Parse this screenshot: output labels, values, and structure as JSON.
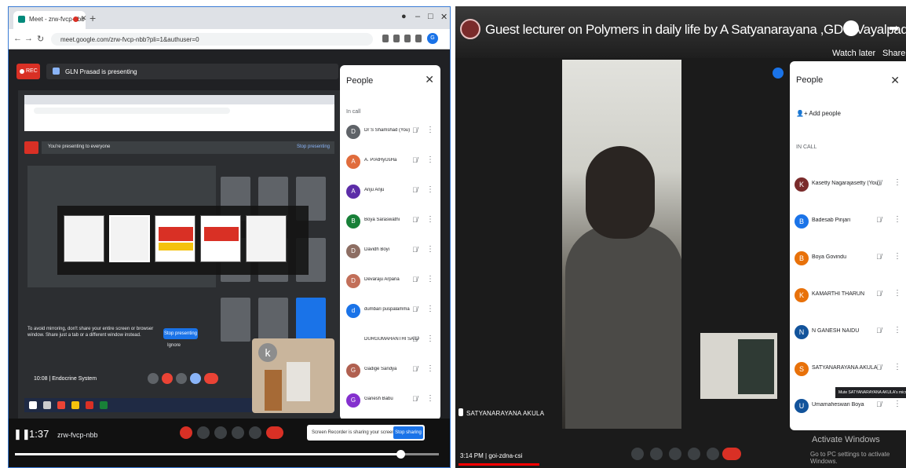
{
  "left": {
    "browser": {
      "tab_label": "Meet - zrw-fvcp-nbb",
      "address": "meet.google.com/zrw-fvcp-nbb?pli=1&authuser=0"
    },
    "meet": {
      "rec_label": "REC",
      "presenting_text": "GLN Prasad is presenting"
    },
    "shared_screen": {
      "sharing_banner": "You're presenting to everyone",
      "stop_presenting": "Stop presenting",
      "mirror_text": "To avoid mirroring, don't share your entire screen or browser window. Share just a tab or a different window instead.",
      "stop_button": "Stop presenting",
      "ignore_link": "Ignore",
      "meeting_info": "10:08 | Endocrine System",
      "pip_initial": "k"
    },
    "people": {
      "title": "People",
      "in_call": "In call",
      "members": [
        {
          "initial": "D",
          "name": "Dr S Shamshad (You)",
          "color": "#5f6368"
        },
        {
          "initial": "A",
          "name": "A. PrAtHyUsHa",
          "color": "#e06c3c"
        },
        {
          "initial": "A",
          "name": "Anju Anju",
          "color": "#5c2da8"
        },
        {
          "initial": "B",
          "name": "Boya Saraswathi",
          "color": "#188038"
        },
        {
          "initial": "D",
          "name": "Davidh Boyi",
          "color": "#8d6e63"
        },
        {
          "initial": "D",
          "name": "Devaraju Arpana",
          "color": "#c26f59"
        },
        {
          "initial": "d",
          "name": "dumbari puspalamma",
          "color": "#1a73e8"
        },
        {
          "initial": "",
          "name": "DURGUMAHANTHI SAILA...",
          "color": "#ffffff"
        },
        {
          "initial": "G",
          "name": "Gadige Sandya",
          "color": "#b06050"
        },
        {
          "initial": "G",
          "name": "Ganesh Babu",
          "color": "#8430ce"
        }
      ]
    },
    "player": {
      "time": "1:37",
      "meeting_code": "zrw-fvcp-nbb",
      "recorder_notice": "Screen Recorder is sharing your screen and audio.",
      "stop_sharing": "Stop sharing",
      "progress": 0.91
    }
  },
  "right": {
    "video_title": "Guest lecturer on Polymers in daily life by A Satyanarayana ,GDC,Vayalpadu",
    "watch_later": "Watch later",
    "share": "Share",
    "speaker_name": "SATYANARAYANA AKULA",
    "meeting_time": "3:14 PM",
    "meeting_code": "goi-zdna-csi",
    "activate_windows": "Activate Windows",
    "go_to_pc": "Go to PC settings to activate Windows.",
    "people": {
      "title": "People",
      "add_people": "Add people",
      "in_call": "IN CALL",
      "members": [
        {
          "initial": "K",
          "name": "Kasetty Nagarajasetty (You)",
          "color": "#7a2b2b"
        },
        {
          "initial": "B",
          "name": "Badesab Pinjari",
          "color": "#1a73e8"
        },
        {
          "initial": "B",
          "name": "Boya Govindu",
          "color": "#e8710a"
        },
        {
          "initial": "K",
          "name": "KAMARTHI THARUN",
          "color": "#e8710a"
        },
        {
          "initial": "N",
          "name": "N GANESH NAIDU",
          "color": "#12539b"
        },
        {
          "initial": "S",
          "name": "SATYANARAYANA AKULA",
          "color": "#e8710a"
        },
        {
          "initial": "U",
          "name": "Umamaheswari Boya",
          "color": "#12539b"
        }
      ],
      "tooltip": "Mute SATYANARAYANA AKULA's microphone"
    },
    "progress": 0.18
  }
}
